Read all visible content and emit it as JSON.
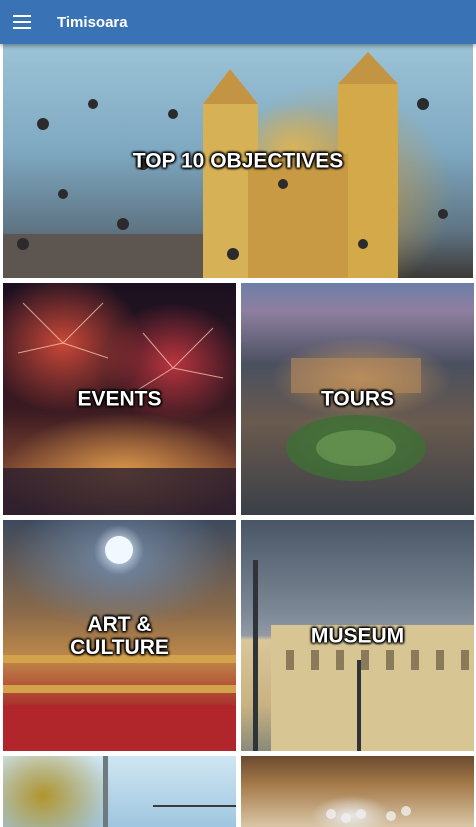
{
  "app": {
    "title": "Timisoara"
  },
  "tiles": [
    {
      "id": "top10",
      "label": "TOP 10 OBJECTIVES"
    },
    {
      "id": "events",
      "label": "EVENTS"
    },
    {
      "id": "tours",
      "label": "TOURS"
    },
    {
      "id": "art",
      "label": "ART &\nCULTURE"
    },
    {
      "id": "museum",
      "label": "MUSEUM"
    },
    {
      "id": "parks",
      "label": ""
    },
    {
      "id": "shopping",
      "label": ""
    }
  ],
  "colors": {
    "appbar": "#3a73b5",
    "label_text": "#ffffff"
  },
  "icons": {
    "menu": "hamburger-menu-icon"
  }
}
